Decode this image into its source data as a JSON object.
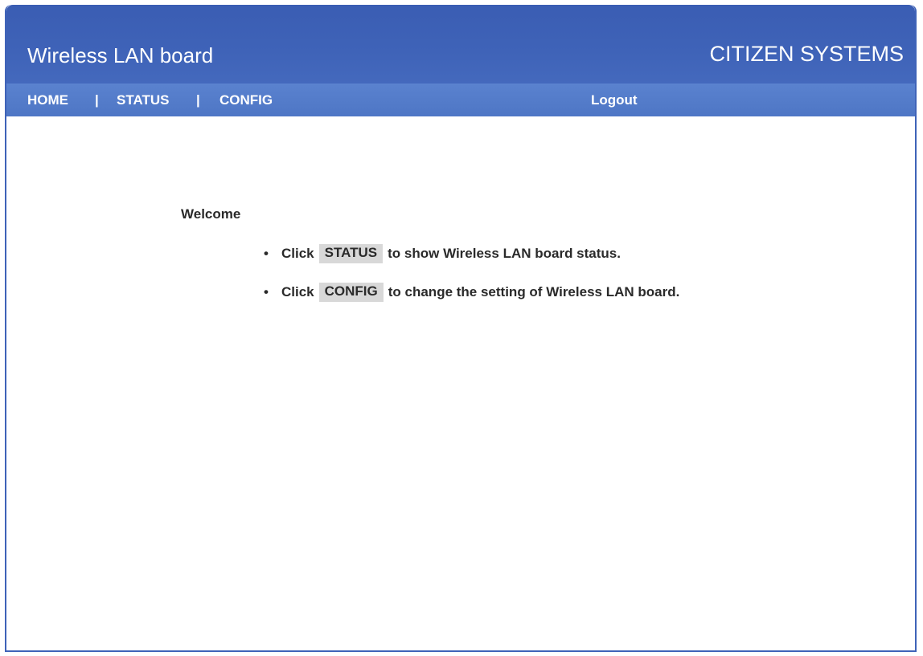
{
  "header": {
    "title": "Wireless LAN board",
    "brand": "CITIZEN SYSTEMS"
  },
  "nav": {
    "home": "HOME",
    "status": "STATUS",
    "config": "CONFIG",
    "separator": "|",
    "logout": "Logout"
  },
  "content": {
    "welcome": "Welcome",
    "items": [
      {
        "bullet": "•",
        "prefix": "Click",
        "button": "STATUS",
        "suffix": "to show Wireless LAN board status."
      },
      {
        "bullet": "•",
        "prefix": "Click",
        "button": "CONFIG",
        "suffix": "to change the setting of Wireless LAN board."
      }
    ]
  },
  "colors": {
    "header_bg": "#3f63b8",
    "navbar_bg": "#5a82cf",
    "button_bg": "#d8d8d8",
    "text": "#2a2a2a"
  }
}
